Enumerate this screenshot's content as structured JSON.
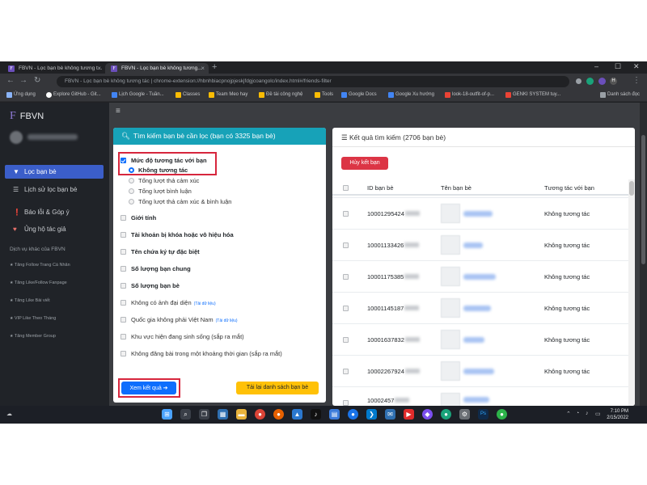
{
  "browser": {
    "tabs": [
      {
        "label": "FBVN - Lọc bạn bè không tương t..."
      },
      {
        "label": "FBVN - Lọc bạn bè không tương..."
      }
    ],
    "new_tab": "+",
    "window_controls": [
      "–",
      "☐",
      "✕"
    ],
    "url": "FBVN - Lọc bạn bè không tương tác  |  chrome-extension://hbnhbiacpnojpjeskjfdgjcoangolc/index.html#/friends-filter",
    "profile_initial": "H",
    "bookmarks": [
      {
        "label": "Ứng dụng",
        "color": "#8ab4f8"
      },
      {
        "label": "Explore GitHub - Git...",
        "color": "#ffffff"
      },
      {
        "label": "Lịch Google - Tuần...",
        "color": "#4285f4"
      },
      {
        "label": "Classes",
        "color": "#fbbc04"
      },
      {
        "label": "Team Meo hay",
        "color": "#fbbc04"
      },
      {
        "label": "Đề tài công nghệ",
        "color": "#fbbc04"
      },
      {
        "label": "Tools",
        "color": "#fbbc04"
      },
      {
        "label": "Google Docs",
        "color": "#4285f4"
      },
      {
        "label": "Google Xu hướng",
        "color": "#4285f4"
      },
      {
        "label": "look-18-outfit-of-p...",
        "color": "#ea4335"
      },
      {
        "label": "GENKI SYSTEM tuy...",
        "color": "#ea4335"
      }
    ],
    "reading_list": "Danh sách đọc"
  },
  "sidebar": {
    "brand_logo": "F",
    "brand": "FBVN",
    "items": [
      {
        "icon": "filter-icon",
        "glyph": "▼",
        "label": "Lọc bạn bè",
        "active": true
      },
      {
        "icon": "history-icon",
        "glyph": "☰",
        "label": "Lịch sử lọc bạn bè",
        "active": false
      }
    ],
    "items2": [
      {
        "icon": "report-icon",
        "glyph": "❗",
        "label": "Báo lỗi & Góp ý"
      },
      {
        "icon": "heart-icon",
        "glyph": "♥",
        "label": "Ủng hộ tác giả"
      }
    ],
    "services_heading": "Dịch vụ khác của FBVN",
    "services": [
      "Tăng Follow Trang Cá Nhân",
      "Tăng Like/Follow Fanpage",
      "Tăng Like Bài viết",
      "VIP Like Theo Tháng",
      "Tăng Member Group"
    ]
  },
  "filter_panel": {
    "title": "Tìm kiếm bạn bè cần lọc (bạn có 3325 bạn bè)",
    "interaction_label": "Mức độ tương tác với bạn",
    "interaction_options": [
      {
        "label": "Không tương tác",
        "selected": true
      },
      {
        "label": "Tổng lượt thả cảm xúc",
        "selected": false
      },
      {
        "label": "Tổng lượt bình luận",
        "selected": false
      },
      {
        "label": "Tổng lượt thả cảm xúc & bình luận",
        "selected": false
      }
    ],
    "filters": [
      {
        "label": "Giới tính",
        "tag": ""
      },
      {
        "label": "Tài khoản bị khóa hoặc vô hiệu hóa",
        "tag": ""
      },
      {
        "label": "Tên chứa ký tự đặc biệt",
        "tag": ""
      },
      {
        "label": "Số lượng bạn chung",
        "tag": ""
      },
      {
        "label": "Số lượng bạn bè",
        "tag": ""
      },
      {
        "label": "Không có ảnh đại diện",
        "tag": "(Tải dữ liệu)"
      },
      {
        "label": "Quốc gia không phải Việt Nam",
        "tag": "(Tải dữ liệu)"
      },
      {
        "label": "Khu vực hiện đang sinh sống (sắp ra mắt)",
        "tag": ""
      },
      {
        "label": "Không đăng bài trong một khoảng thời gian (sắp ra mắt)",
        "tag": ""
      }
    ],
    "view_results": "Xem kết quả ➔",
    "reload": "Tải lại danh sách bạn bè"
  },
  "results_panel": {
    "title": "Kết quả tìm kiếm (2706 bạn bè)",
    "unfriend": "Hủy kết bạn",
    "columns": {
      "id": "ID bạn bè",
      "name": "Tên bạn bè",
      "interaction": "Tương tác với bạn"
    },
    "rows": [
      {
        "id": "10001295424",
        "interaction": "Không tương tác"
      },
      {
        "id": "10001133426",
        "interaction": "Không tương tác"
      },
      {
        "id": "10001175385",
        "interaction": "Không tương tác"
      },
      {
        "id": "10001145187",
        "interaction": "Không tương tác"
      },
      {
        "id": "10001637832",
        "interaction": "Không tương tác"
      },
      {
        "id": "10002267924",
        "interaction": "Không tương tác"
      },
      {
        "id": "10002457",
        "interaction": ""
      }
    ]
  },
  "taskbar": {
    "apps": [
      {
        "name": "start-icon",
        "glyph": "⊞",
        "color": "#4aa3ff"
      },
      {
        "name": "search-icon",
        "glyph": "⌕",
        "color": "#3a3f48"
      },
      {
        "name": "task-view-icon",
        "glyph": "❐",
        "color": "#3a3f48"
      },
      {
        "name": "widgets-icon",
        "glyph": "▦",
        "color": "#2f6fb0"
      },
      {
        "name": "file-explorer-icon",
        "glyph": "▬",
        "color": "#e8b33c"
      },
      {
        "name": "chrome-icon",
        "glyph": "●",
        "color": "#db4437"
      },
      {
        "name": "firefox-icon",
        "glyph": "●",
        "color": "#e66000"
      },
      {
        "name": "photos-icon",
        "glyph": "▲",
        "color": "#2b78d0"
      },
      {
        "name": "tiktok-icon",
        "glyph": "♪",
        "color": "#111111"
      },
      {
        "name": "store-icon",
        "glyph": "▤",
        "color": "#3c7bd9"
      },
      {
        "name": "chrome-icon",
        "glyph": "●",
        "color": "#1a73e8"
      },
      {
        "name": "vscode-icon",
        "glyph": "❯",
        "color": "#007acc"
      },
      {
        "name": "mail-icon",
        "glyph": "✉",
        "color": "#2f6fb0"
      },
      {
        "name": "youtube-icon",
        "glyph": "▶",
        "color": "#e02b2b"
      },
      {
        "name": "messenger-icon",
        "glyph": "◆",
        "color": "#7b4ff0"
      },
      {
        "name": "edge-icon",
        "glyph": "●",
        "color": "#1aa37a"
      },
      {
        "name": "settings-icon",
        "glyph": "⚙",
        "color": "#6b6f75"
      },
      {
        "name": "photoshop-icon",
        "glyph": "Ps",
        "color": "#0f2a4a"
      },
      {
        "name": "line-icon",
        "glyph": "●",
        "color": "#2db34a"
      }
    ],
    "time": "7:10 PM",
    "date": "2/15/2022"
  }
}
